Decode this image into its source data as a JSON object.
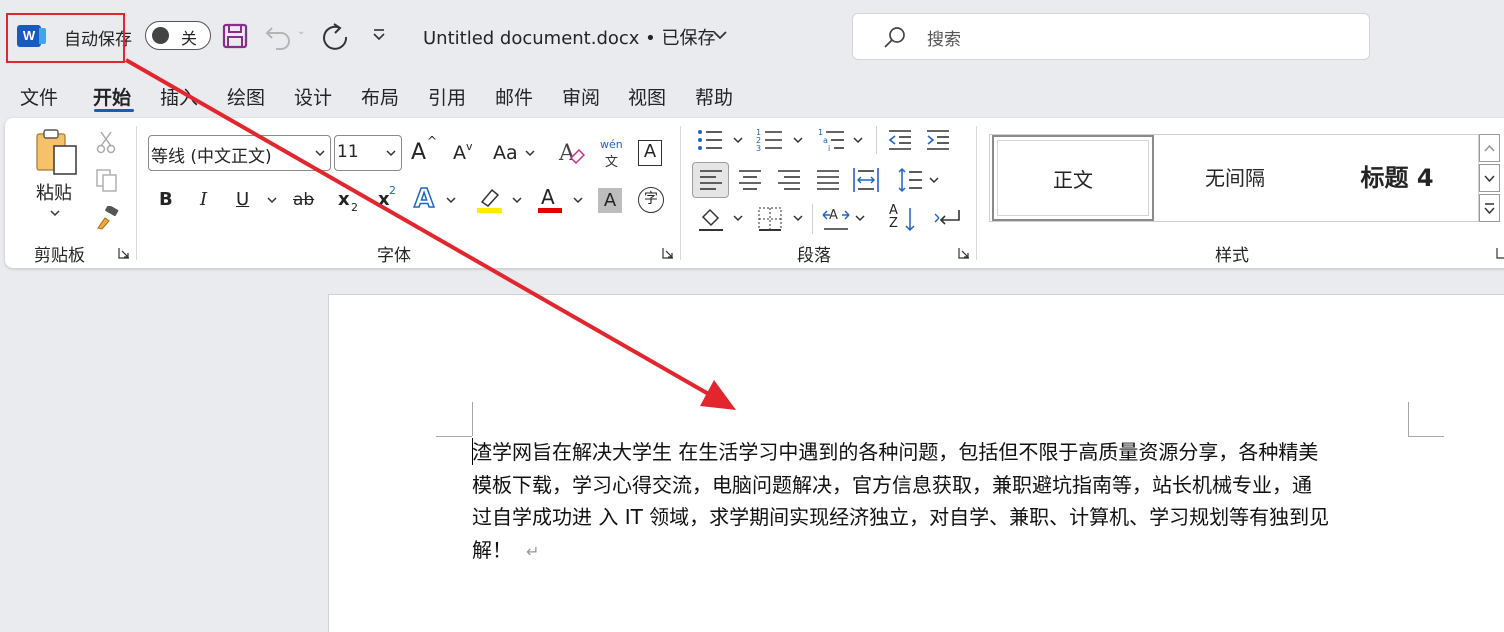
{
  "app": {
    "logo_letter": "W",
    "autosave_label": "自动保存",
    "autosave_state": "关",
    "doc_title": "Untitled document.docx • 已保存",
    "search_placeholder": "搜索"
  },
  "tabs": [
    {
      "label": "文件",
      "active": false
    },
    {
      "label": "开始",
      "active": true
    },
    {
      "label": "插入",
      "active": false
    },
    {
      "label": "绘图",
      "active": false
    },
    {
      "label": "设计",
      "active": false
    },
    {
      "label": "布局",
      "active": false
    },
    {
      "label": "引用",
      "active": false
    },
    {
      "label": "邮件",
      "active": false
    },
    {
      "label": "审阅",
      "active": false
    },
    {
      "label": "视图",
      "active": false
    },
    {
      "label": "帮助",
      "active": false
    }
  ],
  "ribbon": {
    "clipboard": {
      "paste_label": "粘贴",
      "group_label": "剪贴板"
    },
    "font": {
      "font_name": "等线 (中文正文)",
      "font_size": "11",
      "grow_label": "A",
      "shrink_label": "A",
      "case_label": "Aa",
      "bold": "B",
      "italic": "I",
      "underline": "U",
      "strike": "ab",
      "subscript": "x",
      "sub_mark": "2",
      "superscript": "x",
      "sup_mark": "2",
      "effect_label": "A",
      "font_color_label": "A",
      "shading_label": "A",
      "phonetic_top": "wén",
      "phonetic_bottom": "文",
      "border_char": "A",
      "enclose_char": "字",
      "group_label": "字体"
    },
    "paragraph": {
      "group_label": "段落",
      "sort_top": "A",
      "sort_bottom": "Z"
    },
    "styles": {
      "items": [
        "正文",
        "无间隔",
        "标题 4"
      ],
      "group_label": "样式"
    }
  },
  "colors": {
    "accent": "#185abd",
    "annotation_red": "#e3262e",
    "highlight_yellow": "#ffea00",
    "font_color_red": "#e00000",
    "save_purple": "#8b2a8f"
  },
  "document": {
    "lines": [
      "渣学网旨在解决大学生 在生活学习中遇到的各种问题，包括但不限于高质量资源分享，各种精美",
      "模板下载，学习心得交流，电脑问题解决，官方信息获取，兼职避坑指南等，站长机械专业，通",
      "过自学成功进 入 IT 领域，求学期间实现经济独立，对自学、兼职、计算机、学习规划等有独到见",
      "解！"
    ],
    "end_mark": "↵"
  }
}
